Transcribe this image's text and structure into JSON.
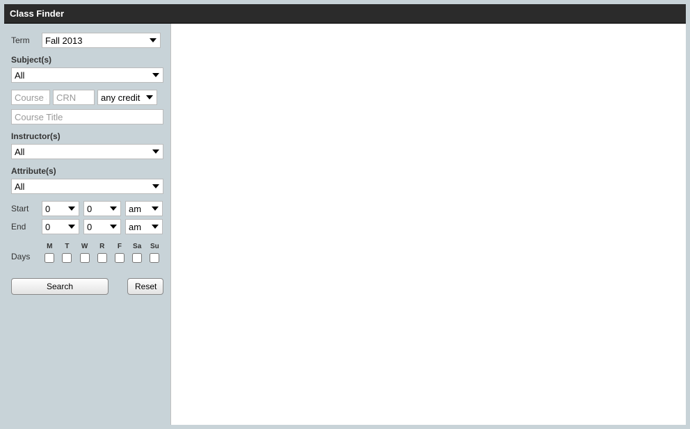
{
  "header": {
    "title": "Class Finder"
  },
  "term": {
    "label": "Term",
    "selected": "Fall 2013"
  },
  "subject": {
    "label": "Subject(s)",
    "selected": "All"
  },
  "courseNum": {
    "placeholder": "Course #"
  },
  "crn": {
    "placeholder": "CRN"
  },
  "credit": {
    "selected": "any credit"
  },
  "courseTitle": {
    "placeholder": "Course Title"
  },
  "instructor": {
    "label": "Instructor(s)",
    "selected": "All"
  },
  "attribute": {
    "label": "Attribute(s)",
    "selected": "All"
  },
  "start": {
    "label": "Start",
    "hour": "0",
    "minute": "0",
    "ampm": "am"
  },
  "end": {
    "label": "End",
    "hour": "0",
    "minute": "0",
    "ampm": "am"
  },
  "days": {
    "label": "Days",
    "items": [
      {
        "abbr": "M"
      },
      {
        "abbr": "T"
      },
      {
        "abbr": "W"
      },
      {
        "abbr": "R"
      },
      {
        "abbr": "F"
      },
      {
        "abbr": "Sa"
      },
      {
        "abbr": "Su"
      }
    ]
  },
  "buttons": {
    "search": "Search",
    "reset": "Reset"
  }
}
